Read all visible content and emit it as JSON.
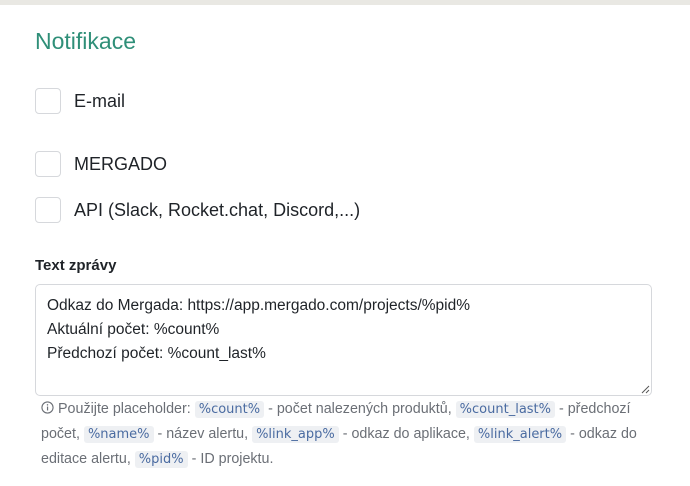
{
  "section": {
    "title": "Notifikace"
  },
  "channels": [
    {
      "label": "E-mail",
      "checked": false
    },
    {
      "label": "MERGADO",
      "checked": false
    },
    {
      "label": "API (Slack, Rocket.chat, Discord,...)",
      "checked": false
    }
  ],
  "message": {
    "label": "Text zprávy",
    "value": "Odkaz do Mergada: https://app.mergado.com/projects/%pid%\nAktuální počet: %count%\nPředchozí počet: %count_last%"
  },
  "help": {
    "icon": "info-icon",
    "intro": "Použijte placeholder:",
    "ph_count": "%count%",
    "desc_count": "- počet nalezených produktů,",
    "ph_count_last": "%count_last%",
    "desc_count_last": "- předchozí počet,",
    "ph_name": "%name%",
    "desc_name": "- název alertu,",
    "ph_link_app": "%link_app%",
    "desc_link_app": "- odkaz do aplikace,",
    "ph_link_alert": "%link_alert%",
    "desc_link_alert": "- odkaz do editace alertu,",
    "ph_pid": "%pid%",
    "desc_pid": "- ID projektu."
  }
}
